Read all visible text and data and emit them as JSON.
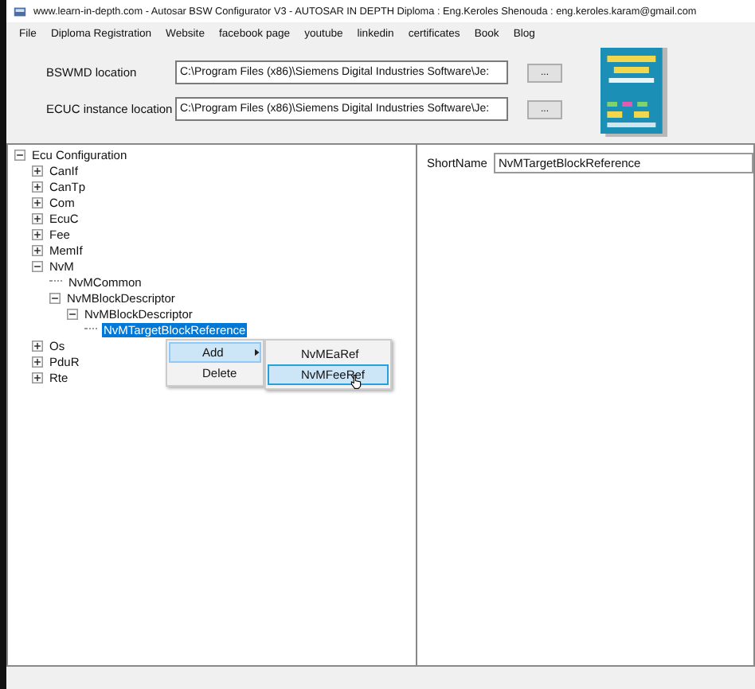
{
  "window": {
    "title": "www.learn-in-depth.com - Autosar BSW Configurator V3 - AUTOSAR IN DEPTH Diploma : Eng.Keroles Shenouda : eng.keroles.karam@gmail.com"
  },
  "menu": [
    "File",
    "Diploma Registration",
    "Website",
    "facebook page",
    "youtube",
    "linkedin",
    "certificates",
    "Book",
    "Blog"
  ],
  "locations": [
    {
      "label": "BSWMD location",
      "value": "C:\\Program Files (x86)\\Siemens Digital Industries Software\\Je:",
      "button": "..."
    },
    {
      "label": "ECUC instance location",
      "value": "C:\\Program Files (x86)\\Siemens Digital Industries Software\\Je:",
      "button": "..."
    }
  ],
  "tree": [
    {
      "label": "Ecu Configuration",
      "kind": "node",
      "expanded": true,
      "selected": false,
      "children": [
        {
          "label": "CanIf",
          "kind": "node",
          "expanded": false,
          "selected": false
        },
        {
          "label": "CanTp",
          "kind": "node",
          "expanded": false,
          "selected": false
        },
        {
          "label": "Com",
          "kind": "node",
          "expanded": false,
          "selected": false
        },
        {
          "label": "EcuC",
          "kind": "node",
          "expanded": false,
          "selected": false
        },
        {
          "label": "Fee",
          "kind": "node",
          "expanded": false,
          "selected": false
        },
        {
          "label": "MemIf",
          "kind": "node",
          "expanded": false,
          "selected": false
        },
        {
          "label": "NvM",
          "kind": "node",
          "expanded": true,
          "selected": false,
          "children": [
            {
              "label": "NvMCommon",
              "kind": "leaf",
              "selected": false
            },
            {
              "label": "NvMBlockDescriptor",
              "kind": "node",
              "expanded": true,
              "selected": false,
              "children": [
                {
                  "label": "NvMBlockDescriptor",
                  "kind": "node",
                  "expanded": true,
                  "selected": false,
                  "children": [
                    {
                      "label": "NvMTargetBlockReference",
                      "kind": "leaf",
                      "selected": true
                    }
                  ]
                }
              ]
            }
          ]
        },
        {
          "label": "Os",
          "kind": "node",
          "expanded": false,
          "selected": false
        },
        {
          "label": "PduR",
          "kind": "node",
          "expanded": false,
          "selected": false
        },
        {
          "label": "Rte",
          "kind": "node",
          "expanded": false,
          "selected": false
        }
      ]
    }
  ],
  "context_menu": [
    {
      "label": "Add",
      "kind": "submenu",
      "selected": true
    },
    {
      "label": "Delete",
      "kind": "item",
      "selected": false
    }
  ],
  "submenu": [
    {
      "label": "NvMEaRef",
      "selected": false
    },
    {
      "label": "NvMFeeRef",
      "selected": true
    }
  ],
  "properties": {
    "label": "ShortName",
    "value": "NvMTargetBlockReference"
  }
}
